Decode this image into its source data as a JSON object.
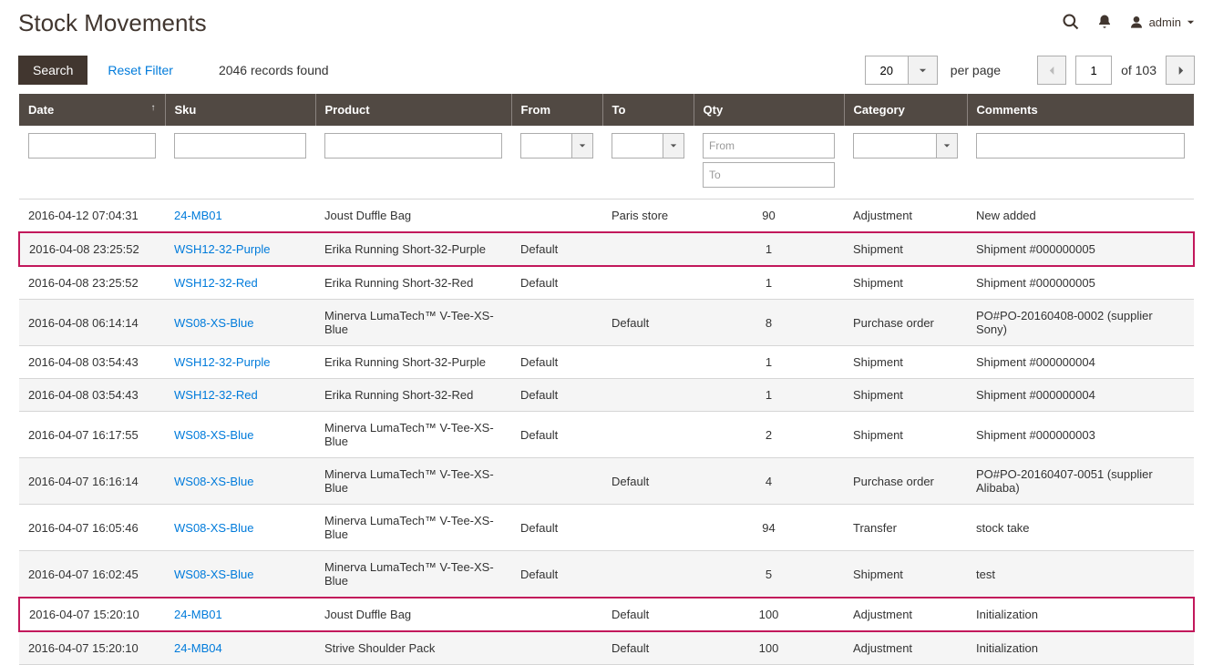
{
  "page_title": "Stock Movements",
  "admin_label": "admin",
  "search_button": "Search",
  "reset_filter": "Reset Filter",
  "records_found": "2046 records found",
  "per_page_value": "20",
  "per_page_label": "per page",
  "page_current": "1",
  "page_total_label": "of 103",
  "columns": {
    "date": "Date",
    "sku": "Sku",
    "product": "Product",
    "from": "From",
    "to": "To",
    "qty": "Qty",
    "category": "Category",
    "comments": "Comments"
  },
  "filters": {
    "qty_from_placeholder": "From",
    "qty_to_placeholder": "To"
  },
  "rows": [
    {
      "date": "2016-04-12 07:04:31",
      "sku": "24-MB01",
      "product": "Joust Duffle Bag",
      "from": "",
      "to": "Paris store",
      "qty": "90",
      "category": "Adjustment",
      "comments": "New added",
      "hl": false
    },
    {
      "date": "2016-04-08 23:25:52",
      "sku": "WSH12-32-Purple",
      "product": "Erika Running Short-32-Purple",
      "from": "Default",
      "to": "",
      "qty": "1",
      "category": "Shipment",
      "comments": "Shipment #000000005",
      "hl": true
    },
    {
      "date": "2016-04-08 23:25:52",
      "sku": "WSH12-32-Red",
      "product": "Erika Running Short-32-Red",
      "from": "Default",
      "to": "",
      "qty": "1",
      "category": "Shipment",
      "comments": "Shipment #000000005",
      "hl": false
    },
    {
      "date": "2016-04-08 06:14:14",
      "sku": "WS08-XS-Blue",
      "product": "Minerva LumaTech™ V-Tee-XS-Blue",
      "from": "",
      "to": "Default",
      "qty": "8",
      "category": "Purchase order",
      "comments": "PO#PO-20160408-0002 (supplier Sony)",
      "hl": false
    },
    {
      "date": "2016-04-08 03:54:43",
      "sku": "WSH12-32-Purple",
      "product": "Erika Running Short-32-Purple",
      "from": "Default",
      "to": "",
      "qty": "1",
      "category": "Shipment",
      "comments": "Shipment #000000004",
      "hl": false
    },
    {
      "date": "2016-04-08 03:54:43",
      "sku": "WSH12-32-Red",
      "product": "Erika Running Short-32-Red",
      "from": "Default",
      "to": "",
      "qty": "1",
      "category": "Shipment",
      "comments": "Shipment #000000004",
      "hl": false
    },
    {
      "date": "2016-04-07 16:17:55",
      "sku": "WS08-XS-Blue",
      "product": "Minerva LumaTech™ V-Tee-XS-Blue",
      "from": "Default",
      "to": "",
      "qty": "2",
      "category": "Shipment",
      "comments": "Shipment #000000003",
      "hl": false
    },
    {
      "date": "2016-04-07 16:16:14",
      "sku": "WS08-XS-Blue",
      "product": "Minerva LumaTech™ V-Tee-XS-Blue",
      "from": "",
      "to": "Default",
      "qty": "4",
      "category": "Purchase order",
      "comments": "PO#PO-20160407-0051 (supplier Alibaba)",
      "hl": false
    },
    {
      "date": "2016-04-07 16:05:46",
      "sku": "WS08-XS-Blue",
      "product": "Minerva LumaTech™ V-Tee-XS-Blue",
      "from": "Default",
      "to": "",
      "qty": "94",
      "category": "Transfer",
      "comments": "stock take",
      "hl": false
    },
    {
      "date": "2016-04-07 16:02:45",
      "sku": "WS08-XS-Blue",
      "product": "Minerva LumaTech™ V-Tee-XS-Blue",
      "from": "Default",
      "to": "",
      "qty": "5",
      "category": "Shipment",
      "comments": "test",
      "hl": false
    },
    {
      "date": "2016-04-07 15:20:10",
      "sku": "24-MB01",
      "product": "Joust Duffle Bag",
      "from": "",
      "to": "Default",
      "qty": "100",
      "category": "Adjustment",
      "comments": "Initialization",
      "hl": true
    },
    {
      "date": "2016-04-07 15:20:10",
      "sku": "24-MB04",
      "product": "Strive Shoulder Pack",
      "from": "",
      "to": "Default",
      "qty": "100",
      "category": "Adjustment",
      "comments": "Initialization",
      "hl": false
    }
  ]
}
